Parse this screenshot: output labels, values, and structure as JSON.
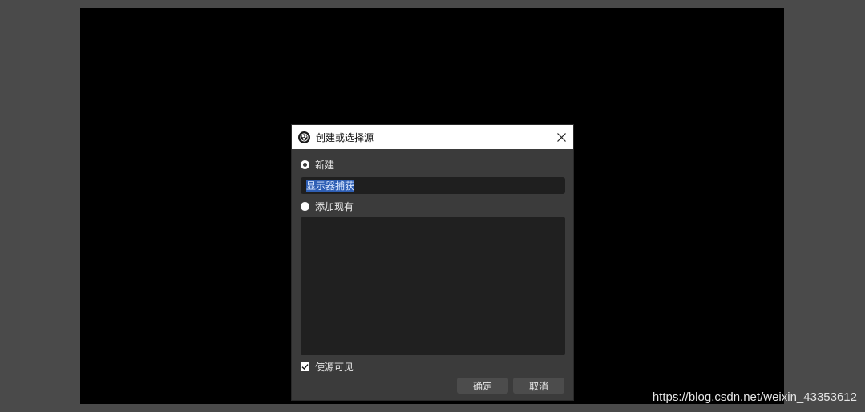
{
  "dialog": {
    "title": "创建或选择源",
    "new_label": "新建",
    "name_value": "显示器捕获",
    "add_existing_label": "添加现有",
    "visible_label": "使源可见",
    "ok_label": "确定",
    "cancel_label": "取消"
  },
  "icons": {
    "app": "obs-logo-icon",
    "close": "close-icon",
    "check": "check-icon"
  },
  "watermark": "https://blog.csdn.net/weixin_43353612"
}
